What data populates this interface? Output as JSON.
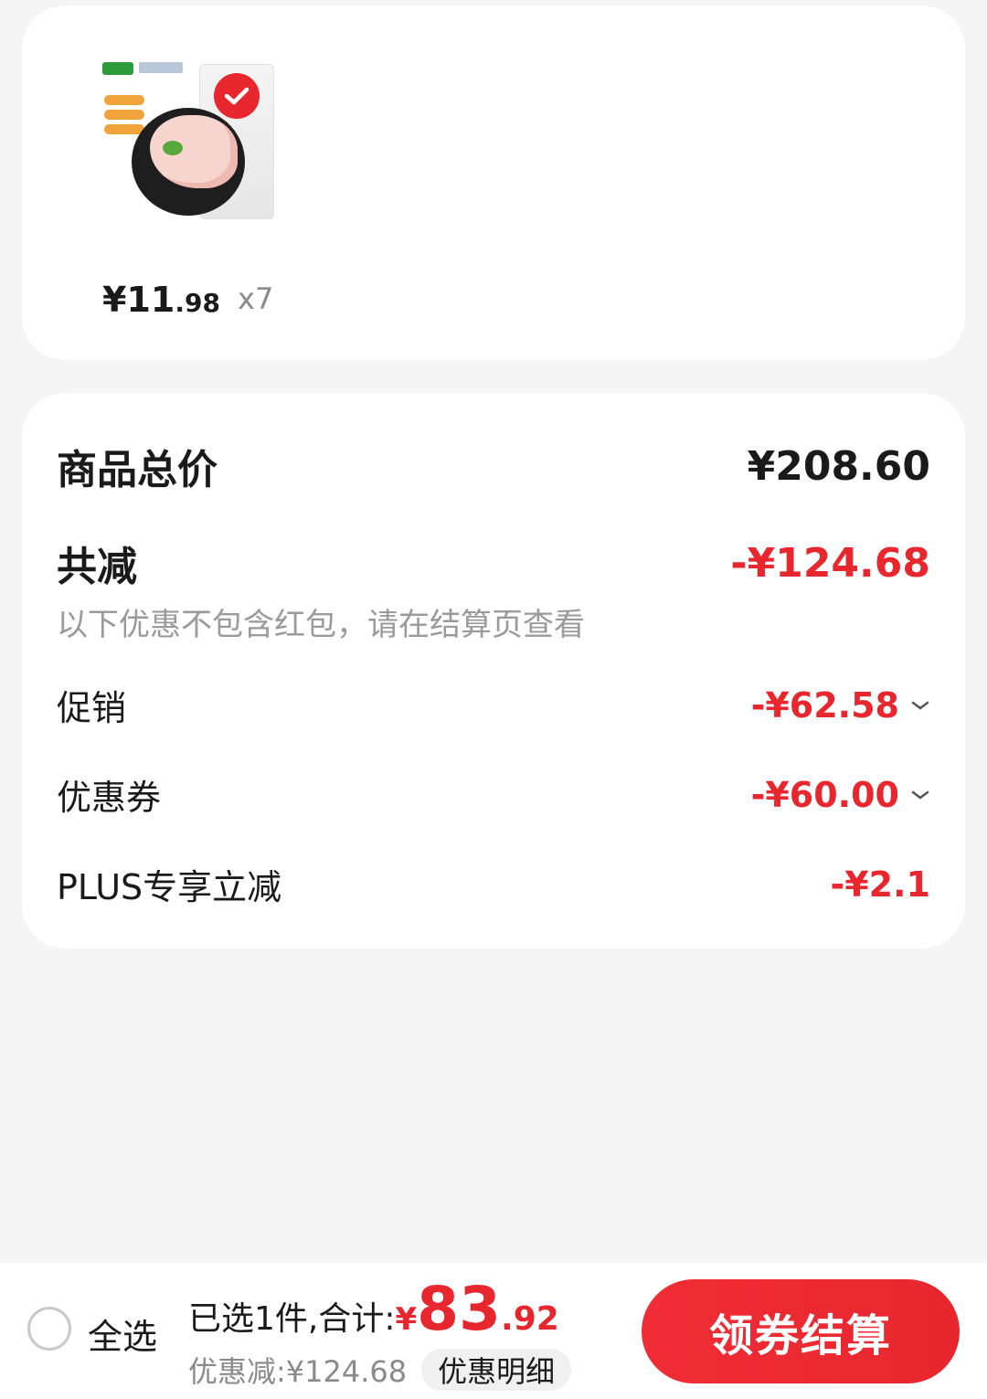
{
  "product": {
    "image_alt": "chicken-leg-product",
    "price_int": "¥11",
    "price_dec": ".98",
    "quantity": "x7",
    "selected": true
  },
  "summary": {
    "total_label": "商品总价",
    "total_value": "¥208.60",
    "reduce_label": "共减",
    "reduce_value": "-¥124.68",
    "note": "以下优惠不包含红包，请在结算页查看",
    "items": [
      {
        "label": "促销",
        "value": "-¥62.58",
        "expandable": true
      },
      {
        "label": "优惠券",
        "value": "-¥60.00",
        "expandable": true
      },
      {
        "label": "PLUS专享立减",
        "value": "-¥2.1",
        "expandable": false
      }
    ]
  },
  "colors": {
    "accent": "#e8262d",
    "text": "#1a1a1a",
    "muted": "#9a9a9a",
    "background": "#f5f5f5"
  },
  "bottom_bar": {
    "select_all_label": "全选",
    "total_prefix": "已选1件,合计:",
    "total_symbol": "¥",
    "total_int": "83",
    "total_dec": ".92",
    "discount_text": "优惠减:¥124.68",
    "detail_label": "优惠明细",
    "checkout_label": "领券结算"
  }
}
